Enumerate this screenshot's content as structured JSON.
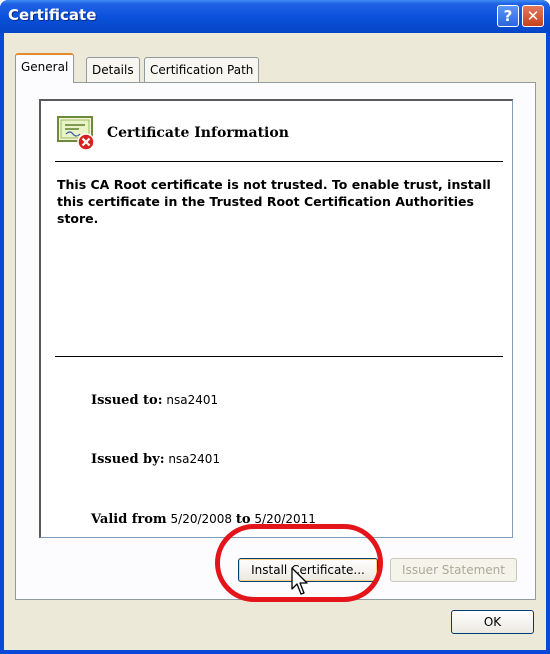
{
  "window": {
    "title": "Certificate"
  },
  "titlebar_buttons": {
    "help": "?",
    "close": "✕"
  },
  "tabs": [
    {
      "label": "General"
    },
    {
      "label": "Details"
    },
    {
      "label": "Certification Path"
    }
  ],
  "info": {
    "heading": "Certificate Information",
    "message": "This CA Root certificate is not trusted. To enable trust, install this certificate in the Trusted Root Certification Authorities store.",
    "issued_to_label": "Issued to:",
    "issued_to": "nsa2401",
    "issued_by_label": "Issued by:",
    "issued_by": "nsa2401",
    "valid_from_label": "Valid from",
    "valid_from": "5/20/2008",
    "valid_to_label": "to",
    "valid_to": "5/20/2011"
  },
  "buttons": {
    "install": "Install Certificate...",
    "issuer_statement": "Issuer Statement",
    "ok": "OK"
  },
  "colors": {
    "highlight": "#e4141b",
    "titlebar": "#0a4fd9",
    "dialog_bg": "#ece9d8"
  }
}
